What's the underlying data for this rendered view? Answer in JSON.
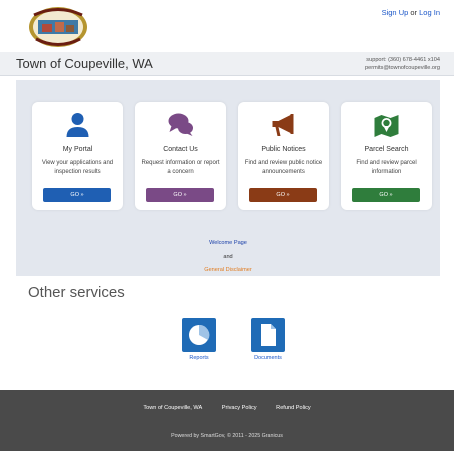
{
  "header": {
    "auth_signup": "Sign Up",
    "auth_or": "or",
    "auth_login": "Log In"
  },
  "titlebar": {
    "title": "Town of Coupeville, WA",
    "support_phone": "support: (360) 678-4461 x104",
    "support_email": "permits@townofcoupeville.org"
  },
  "cards": [
    {
      "title": "My Portal",
      "desc": "View your applications and inspection results",
      "button": "GO »",
      "color": "#1f5fb3",
      "icon": "person-icon"
    },
    {
      "title": "Contact Us",
      "desc": "Request information or report a concern",
      "button": "GO »",
      "color": "#7a4a86",
      "icon": "chat-bubbles-icon"
    },
    {
      "title": "Public Notices",
      "desc": "Find and review public notice announcements",
      "button": "GO »",
      "color": "#8a3b16",
      "icon": "megaphone-icon"
    },
    {
      "title": "Parcel Search",
      "desc": "Find and review parcel information",
      "button": "GO »",
      "color": "#2f7d3c",
      "icon": "map-pin-icon"
    }
  ],
  "links": {
    "welcome": "Welcome Page",
    "and": "and",
    "disclaimer": "General Disclaimer"
  },
  "other_services": {
    "heading": "Other services",
    "items": [
      {
        "label": "Reports",
        "icon": "pie-chart-icon"
      },
      {
        "label": "Documents",
        "icon": "document-icon"
      }
    ]
  },
  "footer": {
    "links": [
      "Town of Coupeville, WA",
      "Privacy Policy",
      "Refund Policy"
    ],
    "powered": "Powered by SmartGov, © 2011 - 2025 Granicus"
  }
}
